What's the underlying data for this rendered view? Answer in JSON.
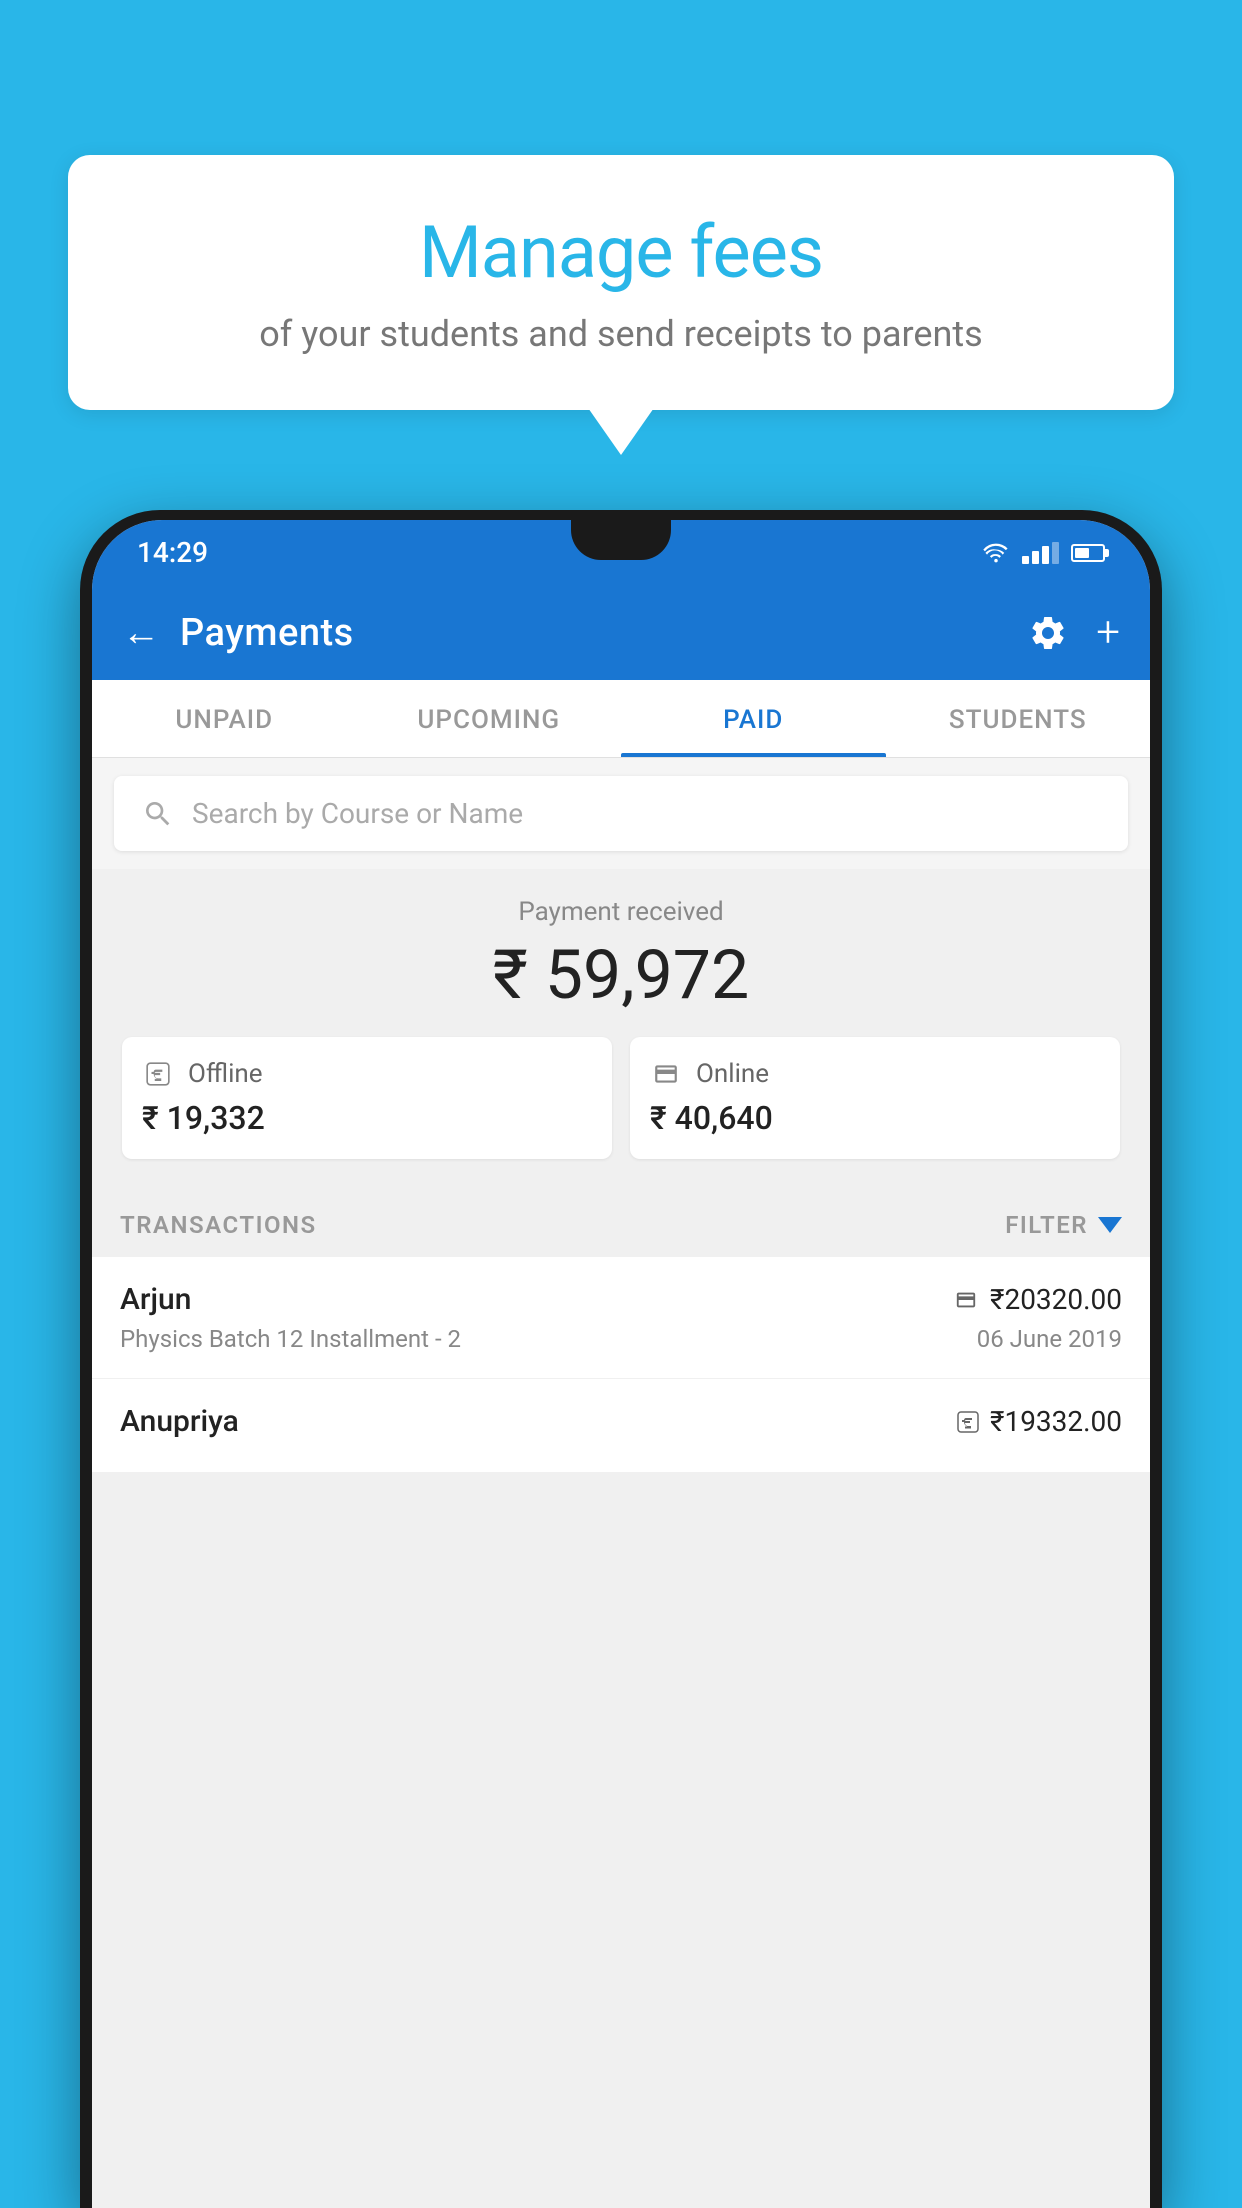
{
  "bubble": {
    "title": "Manage fees",
    "subtitle": "of your students and send receipts to parents"
  },
  "status_bar": {
    "time": "14:29"
  },
  "app_bar": {
    "title": "Payments",
    "back_label": "←",
    "plus_label": "+"
  },
  "tabs": [
    {
      "label": "UNPAID",
      "active": false
    },
    {
      "label": "UPCOMING",
      "active": false
    },
    {
      "label": "PAID",
      "active": true
    },
    {
      "label": "STUDENTS",
      "active": false
    }
  ],
  "search": {
    "placeholder": "Search by Course or Name"
  },
  "payment": {
    "label": "Payment received",
    "amount": "₹ 59,972",
    "offline": {
      "label": "Offline",
      "amount": "₹ 19,332"
    },
    "online": {
      "label": "Online",
      "amount": "₹ 40,640"
    }
  },
  "transactions": {
    "label": "TRANSACTIONS",
    "filter_label": "FILTER",
    "rows": [
      {
        "name": "Arjun",
        "course": "Physics Batch 12 Installment - 2",
        "amount": "₹20320.00",
        "date": "06 June 2019",
        "payment_type": "card"
      },
      {
        "name": "Anupriya",
        "course": "",
        "amount": "₹19332.00",
        "date": "",
        "payment_type": "rupee"
      }
    ]
  }
}
